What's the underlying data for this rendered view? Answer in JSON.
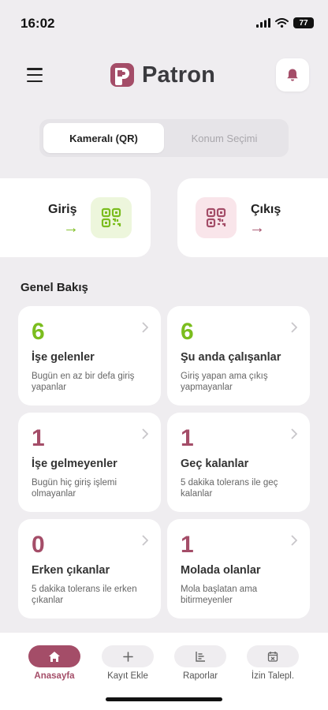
{
  "status_bar": {
    "time": "16:02",
    "battery": "77"
  },
  "header": {
    "brand": "Patron"
  },
  "segment": {
    "tabs": [
      {
        "label": "Kameralı (QR)",
        "active": true
      },
      {
        "label": "Konum Seçimi",
        "active": false
      }
    ]
  },
  "check_in": {
    "label": "Giriş",
    "arrow": "→",
    "color": "#7bbd1e"
  },
  "check_out": {
    "label": "Çıkış",
    "arrow": "→",
    "color": "#a44d68"
  },
  "overview": {
    "title": "Genel Bakış",
    "cards": [
      {
        "value": "6",
        "title": "İşe gelenler",
        "desc": "Bugün en az bir defa giriş yapanlar",
        "color": "#7bbd1e"
      },
      {
        "value": "6",
        "title": "Şu anda çalışanlar",
        "desc": "Giriş yapan ama çıkış yapmayanlar",
        "color": "#7bbd1e"
      },
      {
        "value": "1",
        "title": "İşe gelmeyenler",
        "desc": "Bugün hiç giriş işlemi olmayanlar",
        "color": "#a44d68"
      },
      {
        "value": "1",
        "title": "Geç kalanlar",
        "desc": "5 dakika tolerans ile geç kalanlar",
        "color": "#a44d68"
      },
      {
        "value": "0",
        "title": "Erken çıkanlar",
        "desc": "5 dakika tolerans ile erken çıkanlar",
        "color": "#a44d68"
      },
      {
        "value": "1",
        "title": "Molada olanlar",
        "desc": "Mola başlatan ama bitirmeyenler",
        "color": "#a44d68"
      }
    ]
  },
  "nav": {
    "items": [
      {
        "label": "Anasayfa",
        "icon": "home-icon",
        "active": true
      },
      {
        "label": "Kayıt Ekle",
        "icon": "plus-icon",
        "active": false
      },
      {
        "label": "Raporlar",
        "icon": "report-icon",
        "active": false
      },
      {
        "label": "İzin Talepl.",
        "icon": "calendar-icon",
        "active": false
      }
    ]
  },
  "colors": {
    "accent": "#a44d68",
    "positive": "#7bbd1e",
    "background": "#efedf0"
  }
}
